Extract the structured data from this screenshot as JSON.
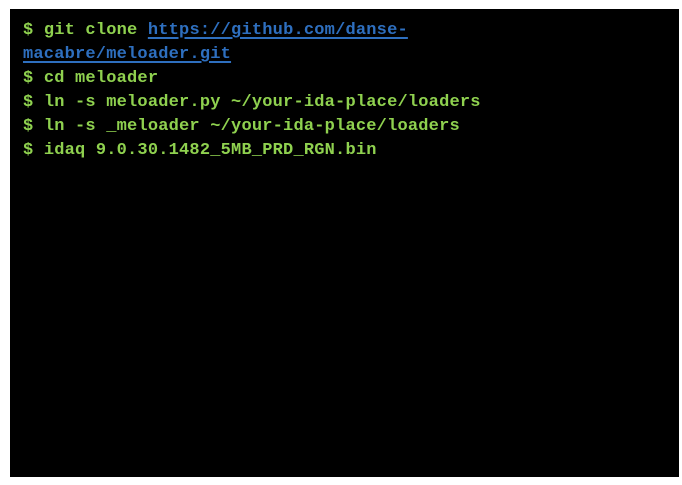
{
  "terminal": {
    "prompt": "$",
    "clone_command": "git clone",
    "repo_url_line1": "https://github.com/danse-",
    "repo_url_line2": "macabre/meloader.git",
    "commands": [
      "cd meloader",
      "ln -s meloader.py ~/your-ida-place/loaders",
      "ln -s _meloader ~/your-ida-place/loaders",
      "idaq 9.0.30.1482_5MB_PRD_RGN.bin"
    ],
    "colors": {
      "background": "#000000",
      "text": "#8fd14f",
      "link": "#2e6fbf"
    }
  }
}
